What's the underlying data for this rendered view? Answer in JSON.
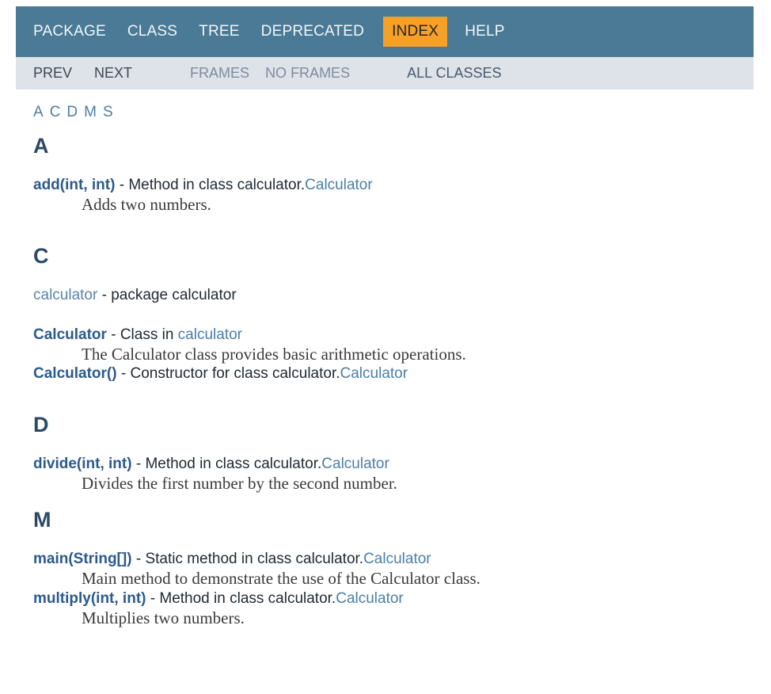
{
  "colors": {
    "header_bg": "#4a7a96",
    "header_text": "#f4f6f8",
    "active_tab_bg": "#f7a028",
    "active_tab_text": "#252525",
    "subnav_bg": "#dee2e9",
    "link": "#4a7ea8",
    "bold_link": "#2c5a8c",
    "heading": "#2c4a68",
    "body_text": "#1f2833",
    "desc_text": "#3a3a3a",
    "page_bg": "#ffffff"
  },
  "topnav": {
    "items": [
      {
        "label": "PACKAGE",
        "active": false
      },
      {
        "label": "CLASS",
        "active": false
      },
      {
        "label": "TREE",
        "active": false
      },
      {
        "label": "DEPRECATED",
        "active": false
      },
      {
        "label": "INDEX",
        "active": true
      },
      {
        "label": "HELP",
        "active": false
      }
    ]
  },
  "subnav": {
    "prev": "PREV",
    "next": "NEXT",
    "frames": "FRAMES",
    "no_frames": "NO FRAMES",
    "all_classes": "ALL CLASSES"
  },
  "letter_index": [
    "A",
    "C",
    "D",
    "M",
    "S"
  ],
  "sections": [
    {
      "letter": "A",
      "entries": [
        {
          "name": "add(int, int)",
          "bold": true,
          "separator": " - ",
          "kind_text": "Method in class calculator.",
          "tail_link": "Calculator",
          "description": "Adds two numbers."
        }
      ]
    },
    {
      "letter": "C",
      "entries": [
        {
          "name": "calculator",
          "bold": false,
          "separator": " - ",
          "kind_text": "package calculator",
          "tail_link": "",
          "description": ""
        },
        {
          "name": "Calculator",
          "bold": true,
          "separator": " - ",
          "kind_text": "Class in ",
          "tail_link": "calculator",
          "description": "The Calculator class provides basic arithmetic operations."
        },
        {
          "name": "Calculator()",
          "bold": true,
          "separator": " - ",
          "kind_text": "Constructor for class calculator.",
          "tail_link": "Calculator",
          "description": ""
        }
      ]
    },
    {
      "letter": "D",
      "entries": [
        {
          "name": "divide(int, int)",
          "bold": true,
          "separator": " - ",
          "kind_text": "Method in class calculator.",
          "tail_link": "Calculator",
          "description": "Divides the first number by the second number."
        }
      ]
    },
    {
      "letter": "M",
      "entries": [
        {
          "name": "main(String[])",
          "bold": true,
          "separator": " - ",
          "kind_text": "Static method in class calculator.",
          "tail_link": "Calculator",
          "description": "Main method to demonstrate the use of the Calculator class."
        },
        {
          "name": "multiply(int, int)",
          "bold": true,
          "separator": " - ",
          "kind_text": "Method in class calculator.",
          "tail_link": "Calculator",
          "description": "Multiplies two numbers."
        }
      ]
    }
  ]
}
